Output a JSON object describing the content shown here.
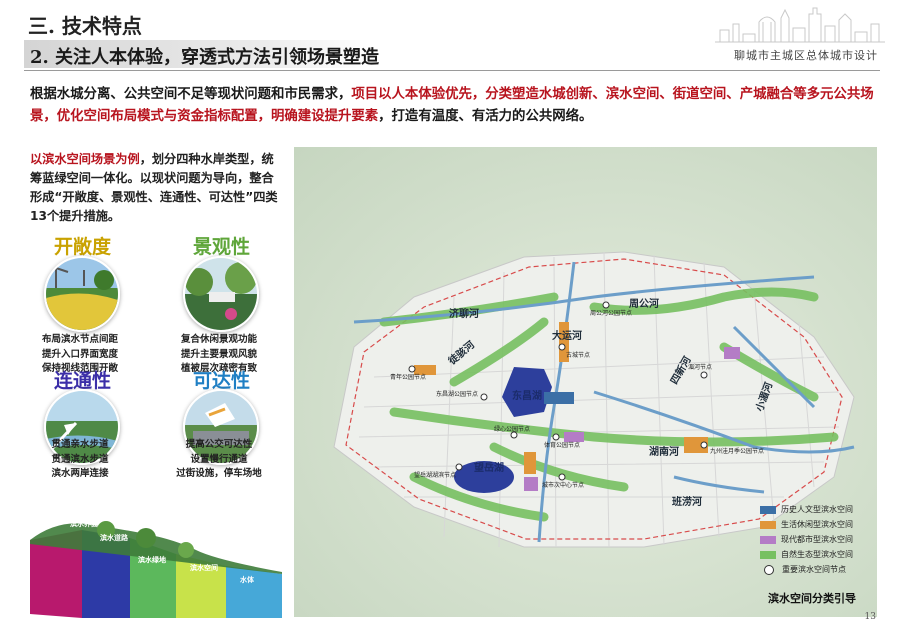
{
  "header": {
    "section_title": "三. 技术特点",
    "subtitle": "2. 关注人本体验，穿透式方法引领场景塑造",
    "project_name": "聊城市主城区总体城市设计"
  },
  "intro": {
    "part1": "根据水城分离、公共空间不足等现状问题和市民需求，",
    "part2_red": "项目以人本体验优先，分类塑造水城创新、滨水空间、街道空间、产城融合等多元公共场景，优化空间布局模式与资金指标配置，明确建设提升要素",
    "part3": "，打造有温度、有活力的公共网络。"
  },
  "left": {
    "desc_red": "以滨水空间场景为例",
    "desc_rest": "，划分四种水岸类型，统筹蓝绿空间一体化。以现状问题为导向，整合形成“开敞度、景观性、连通性、可达性”四类13个提升措施。",
    "categories": [
      {
        "title": "开敞度",
        "color": "#c9a200",
        "lines": [
          "布局滨水节点间距",
          "提升入口界面宽度",
          "保持视线范围开敞"
        ]
      },
      {
        "title": "景观性",
        "color": "#5fa63a",
        "lines": [
          "复合休闲景观功能",
          "提升主要景观风貌",
          "植被层次疏密有致"
        ]
      },
      {
        "title": "连通性",
        "color": "#3b2ea8",
        "lines": [
          "贯通亲水步道",
          "贯通滨水步道",
          "滨水两岸连接"
        ]
      },
      {
        "title": "可达性",
        "color": "#1f7fc4",
        "lines": [
          "提高公交可达性",
          "设置慢行通道",
          "过街设施，停车场地"
        ]
      }
    ],
    "section_labels": [
      "滨水界面",
      "滨水道路",
      "滨水绿地",
      "滨水空间",
      "水体"
    ]
  },
  "map": {
    "rivers": [
      "济聊河",
      "周公河",
      "大运河",
      "徒骇河",
      "小湄河",
      "四新河",
      "东昌湖",
      "望岳湖",
      "湖南河",
      "班涝河"
    ],
    "nodes": [
      "周公河公园节点",
      "古城节点",
      "青年公园节点",
      "东昌湖公园节点",
      "绿心公园节点",
      "望岳湖湖滨节点",
      "体育公园节点",
      "城市次中心节点",
      "湄河节点",
      "九州洼月季公园节点"
    ],
    "legend": [
      {
        "label": "历史人文型滨水空间",
        "color": "#3b6fa6"
      },
      {
        "label": "生活休闲型滨水空间",
        "color": "#e0963a"
      },
      {
        "label": "现代都市型滨水空间",
        "color": "#b47cc6"
      },
      {
        "label": "自然生态型滨水空间",
        "color": "#77c061"
      },
      {
        "label": "重要滨水空间节点",
        "color": "#ffffff"
      }
    ],
    "caption": "滨水空间分类引导"
  },
  "page_number": "13"
}
